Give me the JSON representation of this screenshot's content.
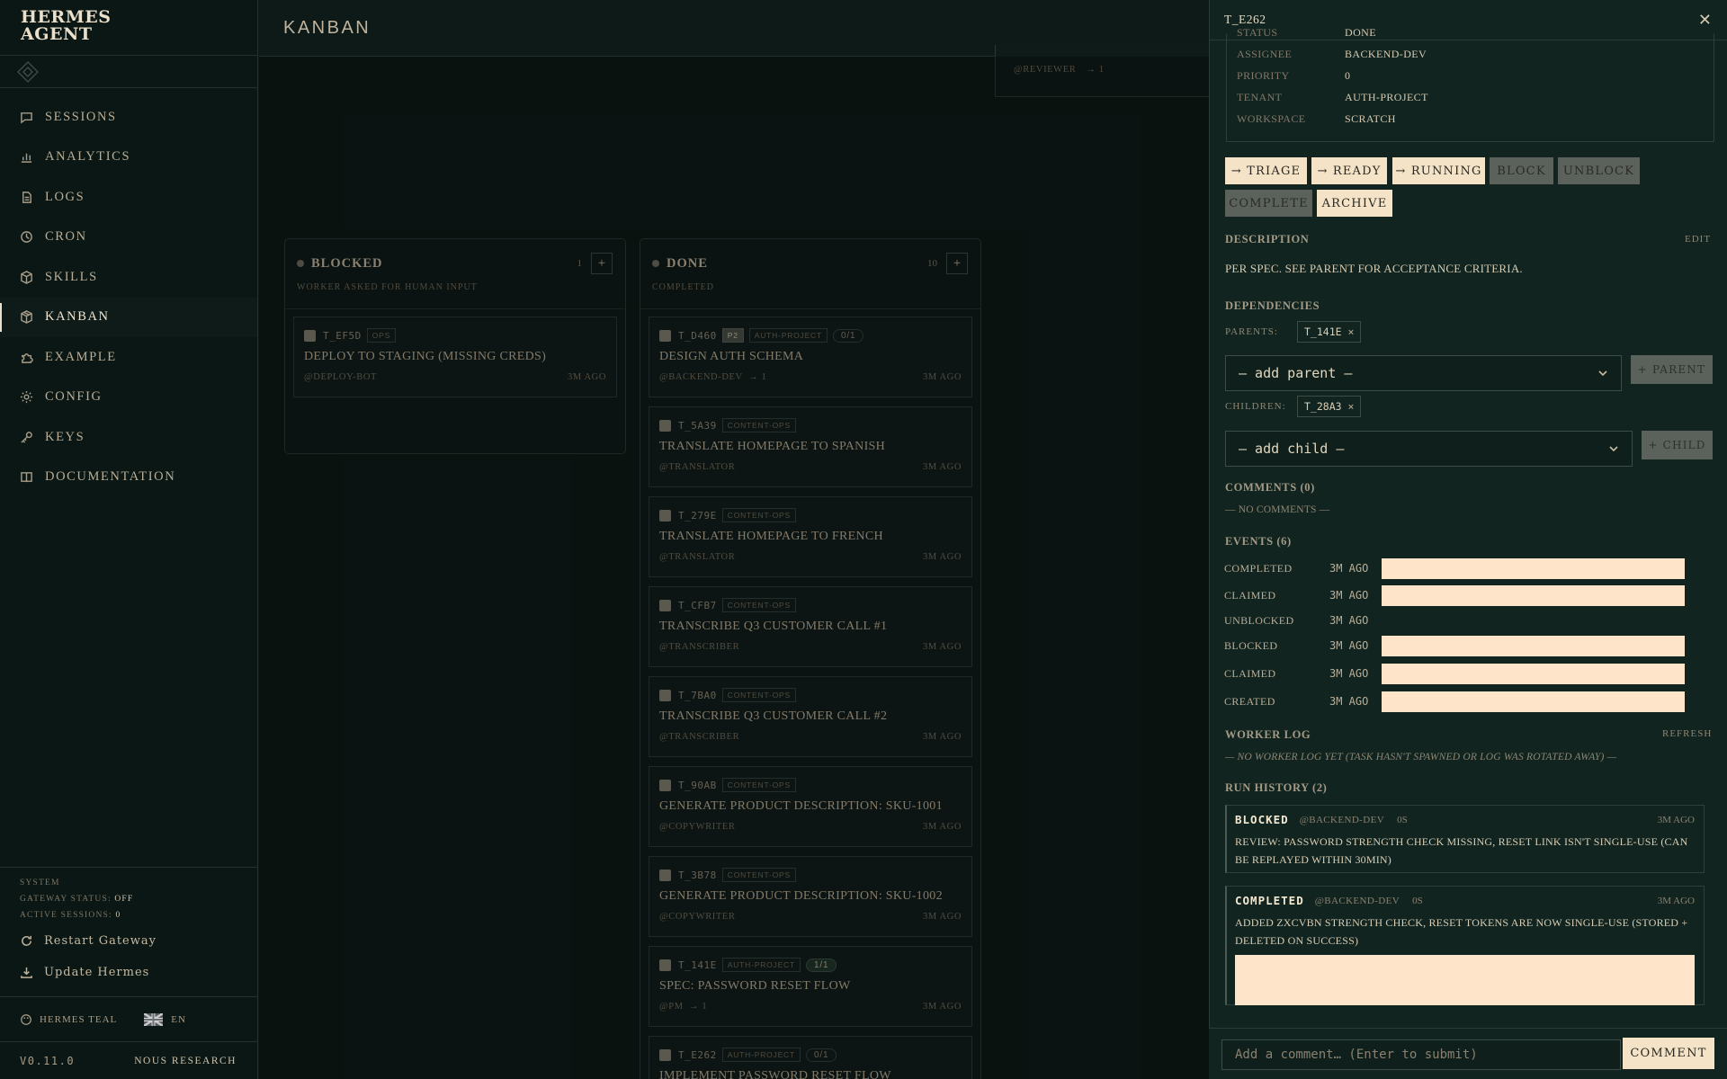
{
  "brand": {
    "line1": "HERMES",
    "line2": "AGENT"
  },
  "nav": [
    {
      "label": "SESSIONS",
      "icon": "chat-icon"
    },
    {
      "label": "ANALYTICS",
      "icon": "bar-chart-icon"
    },
    {
      "label": "LOGS",
      "icon": "file-icon"
    },
    {
      "label": "CRON",
      "icon": "clock-icon"
    },
    {
      "label": "SKILLS",
      "icon": "package-icon"
    },
    {
      "label": "KANBAN",
      "icon": "box-icon",
      "active": true
    },
    {
      "label": "EXAMPLE",
      "icon": "puzzle-icon"
    },
    {
      "label": "CONFIG",
      "icon": "gear-icon"
    },
    {
      "label": "KEYS",
      "icon": "key-icon"
    },
    {
      "label": "DOCUMENTATION",
      "icon": "book-icon"
    }
  ],
  "system": {
    "label": "SYSTEM",
    "gateway_label": "GATEWAY STATUS:",
    "gateway_value": "OFF",
    "sessions_label": "ACTIVE SESSIONS:",
    "sessions_value": "0",
    "restart": "Restart Gateway",
    "update": "Update Hermes"
  },
  "theme": {
    "name": "HERMES TEAL",
    "lang": "EN"
  },
  "footer": {
    "version": "V0.11.0",
    "org": "NOUS RESEARCH"
  },
  "page_title": "KANBAN",
  "top_stub": {
    "who": "@REVIEWER",
    "deps": "→ 1"
  },
  "columns": [
    {
      "title": "BLOCKED",
      "count": "1",
      "subtitle": "WORKER ASKED FOR HUMAN INPUT",
      "cards": [
        {
          "id": "T_EF5D",
          "tags": [
            "OPS"
          ],
          "title": "DEPLOY TO STAGING (MISSING CREDS)",
          "who": "@DEPLOY-BOT",
          "deps": "",
          "ago": "3M AGO"
        }
      ]
    },
    {
      "title": "DONE",
      "count": "10",
      "subtitle": "COMPLETED",
      "cards": [
        {
          "id": "T_D460",
          "prio": "P2",
          "tags": [
            "AUTH-PROJECT"
          ],
          "progress": "0/1",
          "title": "DESIGN AUTH SCHEMA",
          "who": "@BACKEND-DEV",
          "deps": "→ 1",
          "ago": "3M AGO"
        },
        {
          "id": "T_5A39",
          "tags": [
            "CONTENT-OPS"
          ],
          "title": "TRANSLATE HOMEPAGE TO SPANISH",
          "who": "@TRANSLATOR",
          "deps": "",
          "ago": "3M AGO"
        },
        {
          "id": "T_279E",
          "tags": [
            "CONTENT-OPS"
          ],
          "title": "TRANSLATE HOMEPAGE TO FRENCH",
          "who": "@TRANSLATOR",
          "deps": "",
          "ago": "3M AGO"
        },
        {
          "id": "T_CFB7",
          "tags": [
            "CONTENT-OPS"
          ],
          "title": "TRANSCRIBE Q3 CUSTOMER CALL #1",
          "who": "@TRANSCRIBER",
          "deps": "",
          "ago": "3M AGO"
        },
        {
          "id": "T_7BA0",
          "tags": [
            "CONTENT-OPS"
          ],
          "title": "TRANSCRIBE Q3 CUSTOMER CALL #2",
          "who": "@TRANSCRIBER",
          "deps": "",
          "ago": "3M AGO"
        },
        {
          "id": "T_90AB",
          "tags": [
            "CONTENT-OPS"
          ],
          "title": "GENERATE PRODUCT DESCRIPTION: SKU-1001",
          "who": "@COPYWRITER",
          "deps": "",
          "ago": "3M AGO"
        },
        {
          "id": "T_3B78",
          "tags": [
            "CONTENT-OPS"
          ],
          "title": "GENERATE PRODUCT DESCRIPTION: SKU-1002",
          "who": "@COPYWRITER",
          "deps": "",
          "ago": "3M AGO"
        },
        {
          "id": "T_141E",
          "tags": [
            "AUTH-PROJECT"
          ],
          "progress": "1/1",
          "progress_done": true,
          "title": "SPEC: PASSWORD RESET FLOW",
          "who": "@PM",
          "deps": "→ 1",
          "ago": "3M AGO"
        },
        {
          "id": "T_E262",
          "tags": [
            "AUTH-PROJECT"
          ],
          "progress": "0/1",
          "title": "IMPLEMENT PASSWORD RESET FLOW",
          "who": "",
          "deps": "",
          "ago": ""
        }
      ]
    }
  ],
  "drawer": {
    "id": "T_E262",
    "meta": [
      {
        "key": "STATUS",
        "value": "DONE"
      },
      {
        "key": "ASSIGNEE",
        "value": "BACKEND-DEV"
      },
      {
        "key": "PRIORITY",
        "value": "0"
      },
      {
        "key": "TENANT",
        "value": "AUTH-PROJECT"
      },
      {
        "key": "WORKSPACE",
        "value": "SCRATCH"
      }
    ],
    "actions": {
      "triage": "→ TRIAGE",
      "ready": "→ READY",
      "running": "→ RUNNING",
      "block": "BLOCK",
      "unblock": "UNBLOCK",
      "complete": "COMPLETE",
      "archive": "ARCHIVE"
    },
    "description_label": "DESCRIPTION",
    "edit": "EDIT",
    "description": "PER SPEC. SEE PARENT FOR ACCEPTANCE CRITERIA.",
    "dependencies_label": "DEPENDENCIES",
    "parents_label": "PARENTS:",
    "parent_chip": "T_141E",
    "add_parent": "— add parent —",
    "parent_button": "+ PARENT",
    "children_label": "CHILDREN:",
    "child_chip": "T_28A3",
    "add_child": "— add child —",
    "child_button": "+ CHILD",
    "comments_label": "COMMENTS (0)",
    "no_comments": "— NO COMMENTS —",
    "events_label": "EVENTS (6)",
    "events": [
      {
        "name": "COMPLETED",
        "ago": "3M AGO",
        "bar": true
      },
      {
        "name": "CLAIMED",
        "ago": "3M AGO",
        "bar": true
      },
      {
        "name": "UNBLOCKED",
        "ago": "3M AGO",
        "bar": false
      },
      {
        "name": "BLOCKED",
        "ago": "3M AGO",
        "bar": true
      },
      {
        "name": "CLAIMED",
        "ago": "3M AGO",
        "bar": true
      },
      {
        "name": "CREATED",
        "ago": "3M AGO",
        "bar": true
      }
    ],
    "worker_log_label": "WORKER LOG",
    "refresh": "REFRESH",
    "worker_log_empty": "— NO WORKER LOG YET (TASK HASN'T SPAWNED OR LOG WAS ROTATED AWAY) —",
    "run_history_label": "RUN HISTORY (2)",
    "runs": [
      {
        "status": "BLOCKED",
        "who": "@BACKEND-DEV",
        "dur": "0S",
        "ago": "3M AGO",
        "text": "REVIEW: PASSWORD STRENGTH CHECK MISSING, RESET LINK ISN'T SINGLE-USE (CAN BE REPLAYED WITHIN 30MIN)"
      },
      {
        "status": "COMPLETED",
        "who": "@BACKEND-DEV",
        "dur": "0S",
        "ago": "3M AGO",
        "text": "ADDED ZXCVBN STRENGTH CHECK, RESET TOKENS ARE NOW SINGLE-USE (STORED + DELETED ON SUCCESS)"
      }
    ],
    "comment_placeholder": "Add a comment… (Enter to submit)",
    "comment_button": "COMMENT"
  }
}
